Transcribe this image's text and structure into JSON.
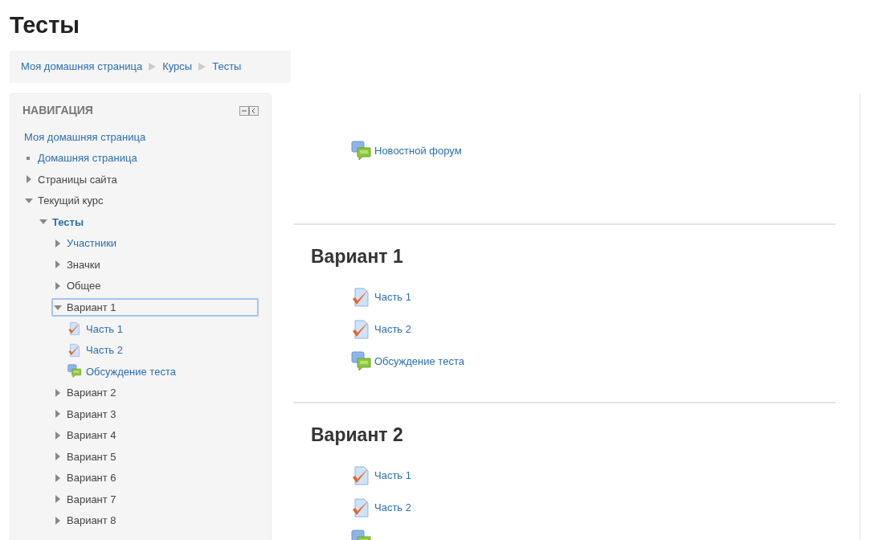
{
  "page_title": "Тесты",
  "breadcrumb": [
    {
      "label": "Моя домашняя страница"
    },
    {
      "label": "Курсы"
    },
    {
      "label": "Тесты"
    }
  ],
  "navigation": {
    "title": "НАВИГАЦИЯ",
    "items": [
      {
        "label": "Моя домашняя страница",
        "kind": "root",
        "link": true,
        "current": false,
        "selected": false,
        "children": [
          {
            "label": "Домашняя страница",
            "kind": "leaf",
            "link": true,
            "current": false,
            "selected": false
          },
          {
            "label": "Страницы сайта",
            "kind": "branch",
            "link": false,
            "current": false,
            "selected": false,
            "expanded": false
          },
          {
            "label": "Текущий курс",
            "kind": "branch",
            "link": false,
            "current": false,
            "selected": false,
            "expanded": true,
            "children": [
              {
                "label": "Тесты",
                "kind": "branch",
                "link": true,
                "current": true,
                "selected": false,
                "expanded": true,
                "children": [
                  {
                    "label": "Участники",
                    "kind": "branch",
                    "link": true,
                    "current": false,
                    "selected": false,
                    "expanded": false
                  },
                  {
                    "label": "Значки",
                    "kind": "branch",
                    "link": false,
                    "current": false,
                    "selected": false,
                    "expanded": false
                  },
                  {
                    "label": "Общее",
                    "kind": "branch",
                    "link": false,
                    "current": false,
                    "selected": false,
                    "expanded": false
                  },
                  {
                    "label": "Вариант 1",
                    "kind": "branch",
                    "link": false,
                    "current": false,
                    "selected": true,
                    "expanded": true,
                    "children": [
                      {
                        "label": "Часть 1",
                        "kind": "quiz",
                        "link": true,
                        "current": false,
                        "selected": false
                      },
                      {
                        "label": "Часть 2",
                        "kind": "quiz",
                        "link": true,
                        "current": false,
                        "selected": false
                      },
                      {
                        "label": "Обсуждение теста",
                        "kind": "forum",
                        "link": true,
                        "current": false,
                        "selected": false
                      }
                    ]
                  },
                  {
                    "label": "Вариант 2",
                    "kind": "branch",
                    "link": false,
                    "current": false,
                    "selected": false,
                    "expanded": false
                  },
                  {
                    "label": "Вариант 3",
                    "kind": "branch",
                    "link": false,
                    "current": false,
                    "selected": false,
                    "expanded": false
                  },
                  {
                    "label": "Вариант 4",
                    "kind": "branch",
                    "link": false,
                    "current": false,
                    "selected": false,
                    "expanded": false
                  },
                  {
                    "label": "Вариант 5",
                    "kind": "branch",
                    "link": false,
                    "current": false,
                    "selected": false,
                    "expanded": false
                  },
                  {
                    "label": "Вариант 6",
                    "kind": "branch",
                    "link": false,
                    "current": false,
                    "selected": false,
                    "expanded": false
                  },
                  {
                    "label": "Вариант 7",
                    "kind": "branch",
                    "link": false,
                    "current": false,
                    "selected": false,
                    "expanded": false
                  },
                  {
                    "label": "Вариант 8",
                    "kind": "branch",
                    "link": false,
                    "current": false,
                    "selected": false,
                    "expanded": false
                  }
                ]
              }
            ]
          }
        ]
      }
    ]
  },
  "sections": [
    {
      "activities": [
        {
          "kind": "forum",
          "label": "Новостной форум"
        }
      ]
    },
    {
      "heading": "Вариант 1",
      "activities": [
        {
          "kind": "quiz",
          "label": "Часть 1"
        },
        {
          "kind": "quiz",
          "label": "Часть 2"
        },
        {
          "kind": "forum",
          "label": "Обсуждение теста"
        }
      ]
    },
    {
      "heading": "Вариант 2",
      "activities": [
        {
          "kind": "quiz",
          "label": "Часть 1"
        },
        {
          "kind": "quiz",
          "label": "Часть 2"
        },
        {
          "kind": "forum"
        }
      ]
    }
  ]
}
